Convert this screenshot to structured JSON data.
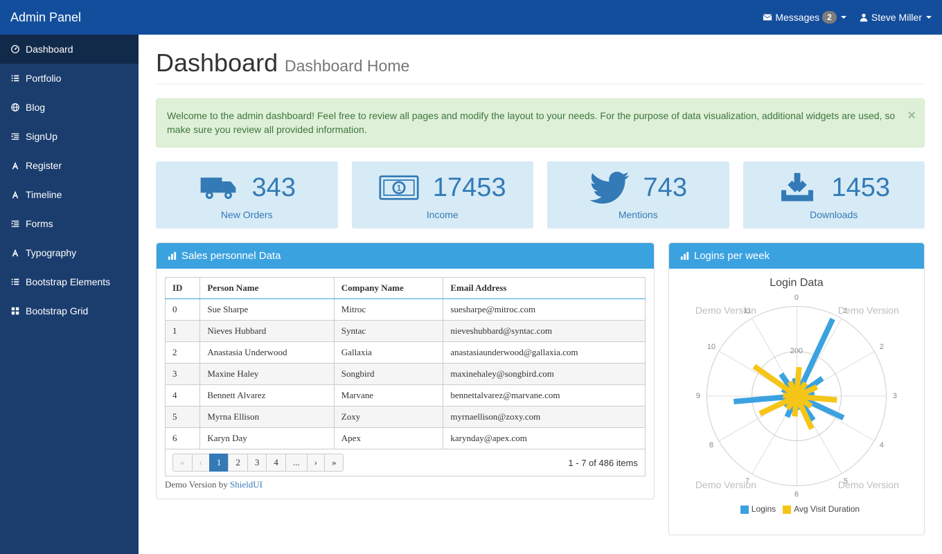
{
  "brand": "Admin Panel",
  "topbar": {
    "messages_label": "Messages",
    "messages_count": "2",
    "user_name": "Steve Miller"
  },
  "sidebar": {
    "items": [
      {
        "icon": "dashboard-icon",
        "label": "Dashboard",
        "active": true
      },
      {
        "icon": "list-icon",
        "label": "Portfolio"
      },
      {
        "icon": "globe-icon",
        "label": "Blog"
      },
      {
        "icon": "indent-icon",
        "label": "SignUp"
      },
      {
        "icon": "font-icon",
        "label": "Register"
      },
      {
        "icon": "font-icon",
        "label": "Timeline"
      },
      {
        "icon": "indent-icon",
        "label": "Forms"
      },
      {
        "icon": "font-icon",
        "label": "Typography"
      },
      {
        "icon": "list-icon",
        "label": "Bootstrap Elements"
      },
      {
        "icon": "grid-icon",
        "label": "Bootstrap Grid"
      }
    ]
  },
  "page": {
    "title": "Dashboard",
    "subtitle": "Dashboard Home"
  },
  "alert": {
    "text": "Welcome to the admin dashboard! Feel free to review all pages and modify the layout to your needs. For the purpose of data visualization, additional widgets are used, so make sure you review all provided information."
  },
  "stats": [
    {
      "icon": "truck-icon",
      "value": "343",
      "label": "New Orders"
    },
    {
      "icon": "money-icon",
      "value": "17453",
      "label": "Income"
    },
    {
      "icon": "twitter-icon",
      "value": "743",
      "label": "Mentions"
    },
    {
      "icon": "download-icon",
      "value": "1453",
      "label": "Downloads"
    }
  ],
  "sales_panel": {
    "title": "Sales personnel Data",
    "columns": [
      "ID",
      "Person Name",
      "Company Name",
      "Email Address"
    ],
    "rows": [
      {
        "id": "0",
        "name": "Sue Sharpe",
        "company": "Mitroc",
        "email": "suesharpe@mitroc.com"
      },
      {
        "id": "1",
        "name": "Nieves Hubbard",
        "company": "Syntac",
        "email": "nieveshubbard@syntac.com"
      },
      {
        "id": "2",
        "name": "Anastasia Underwood",
        "company": "Gallaxia",
        "email": "anastasiaunderwood@gallaxia.com"
      },
      {
        "id": "3",
        "name": "Maxine Haley",
        "company": "Songbird",
        "email": "maxinehaley@songbird.com"
      },
      {
        "id": "4",
        "name": "Bennett Alvarez",
        "company": "Marvane",
        "email": "bennettalvarez@marvane.com"
      },
      {
        "id": "5",
        "name": "Myrna Ellison",
        "company": "Zoxy",
        "email": "myrnaellison@zoxy.com"
      },
      {
        "id": "6",
        "name": "Karyn Day",
        "company": "Apex",
        "email": "karynday@apex.com"
      }
    ],
    "pager": {
      "buttons": [
        "«",
        "‹",
        "1",
        "2",
        "3",
        "4",
        "...",
        "›",
        "»"
      ],
      "active_index": 2,
      "summary": "1 - 7 of 486 items"
    },
    "credit_prefix": "Demo Version",
    "credit_suffix": " by ",
    "credit_link": "ShieldUI"
  },
  "logins_panel": {
    "title": "Logins per week",
    "chart_title": "Login Data",
    "watermark": "Demo Version",
    "axis_labels": [
      "0",
      "1",
      "2",
      "3",
      "4",
      "5",
      "6",
      "7",
      "8",
      "9",
      "10",
      "11"
    ],
    "ring_labels": [
      "0",
      "200"
    ],
    "legend": [
      {
        "color": "#3ba2e0",
        "label": "Logins"
      },
      {
        "color": "#f5c518",
        "label": "Avg Visit Duration"
      }
    ]
  },
  "chart_data": {
    "type": "bar",
    "title": "Login Data",
    "categories": [
      "0",
      "1",
      "2",
      "3",
      "4",
      "5",
      "6",
      "7",
      "8",
      "9",
      "10",
      "11"
    ],
    "series": [
      {
        "name": "Logins",
        "color": "#3ba2e0",
        "values": [
          80,
          380,
          140,
          80,
          230,
          130,
          60,
          100,
          70,
          280,
          70,
          120
        ]
      },
      {
        "name": "Avg Visit Duration",
        "color": "#f5c518",
        "values": [
          130,
          70,
          100,
          180,
          80,
          160,
          90,
          70,
          180,
          60,
          230,
          70
        ]
      }
    ],
    "ylim": [
      0,
      400
    ],
    "polar": true
  }
}
